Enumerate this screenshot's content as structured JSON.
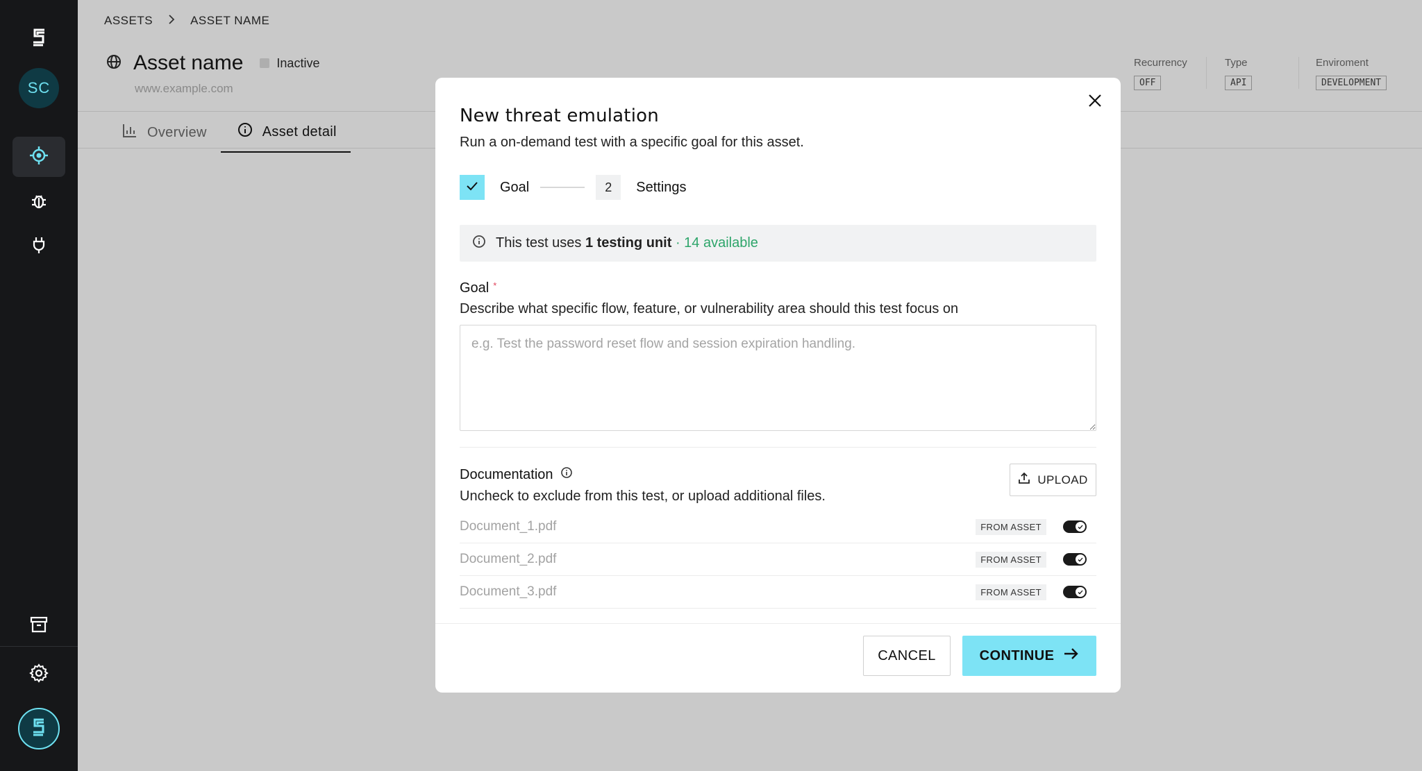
{
  "sidebar": {
    "avatar_initials": "SC",
    "accent_color": "#6ee0f0",
    "items": [
      {
        "name": "target",
        "icon": "target-icon",
        "active": true
      },
      {
        "name": "bug",
        "icon": "bug-icon",
        "active": false
      },
      {
        "name": "plug",
        "icon": "plug-icon",
        "active": false
      },
      {
        "name": "archive",
        "icon": "archive-icon",
        "active": false
      },
      {
        "name": "settings",
        "icon": "gear-icon",
        "active": false
      }
    ]
  },
  "breadcrumb": {
    "root": "ASSETS",
    "current": "ASSET NAME"
  },
  "asset": {
    "title": "Asset name",
    "status": "Inactive",
    "url": "www.example.com",
    "meta": [
      {
        "label": "Recurrency",
        "value": "OFF"
      },
      {
        "label": "Type",
        "value": "API"
      },
      {
        "label": "Enviroment",
        "value": "DEVELOPMENT"
      }
    ]
  },
  "tabs": [
    {
      "label": "Overview",
      "active": false
    },
    {
      "label": "Asset detail",
      "active": true
    }
  ],
  "modal": {
    "title": "New threat emulation",
    "subtitle": "Run a on-demand test with a specific goal for this asset.",
    "steps": [
      {
        "label": "Goal",
        "done": true
      },
      {
        "label": "Settings",
        "number": "2"
      }
    ],
    "info": {
      "prefix": "This test uses ",
      "units": "1 testing unit",
      "available": " · 14 available"
    },
    "goal": {
      "label": "Goal",
      "required_mark": "*",
      "description": "Describe what specific flow, feature, or vulnerability area should this test focus on",
      "placeholder": "e.g. Test the password reset flow and session expiration handling.",
      "value": ""
    },
    "documentation": {
      "label": "Documentation",
      "description": "Uncheck to exclude from this test, or upload additional files.",
      "upload_label": "UPLOAD",
      "files": [
        {
          "name": "Document_1.pdf",
          "source": "FROM ASSET",
          "enabled": true
        },
        {
          "name": "Document_2.pdf",
          "source": "FROM ASSET",
          "enabled": true
        },
        {
          "name": "Document_3.pdf",
          "source": "FROM ASSET",
          "enabled": true
        }
      ]
    },
    "cancel_label": "CANCEL",
    "continue_label": "CONTINUE",
    "primary_color": "#7de3f5"
  }
}
